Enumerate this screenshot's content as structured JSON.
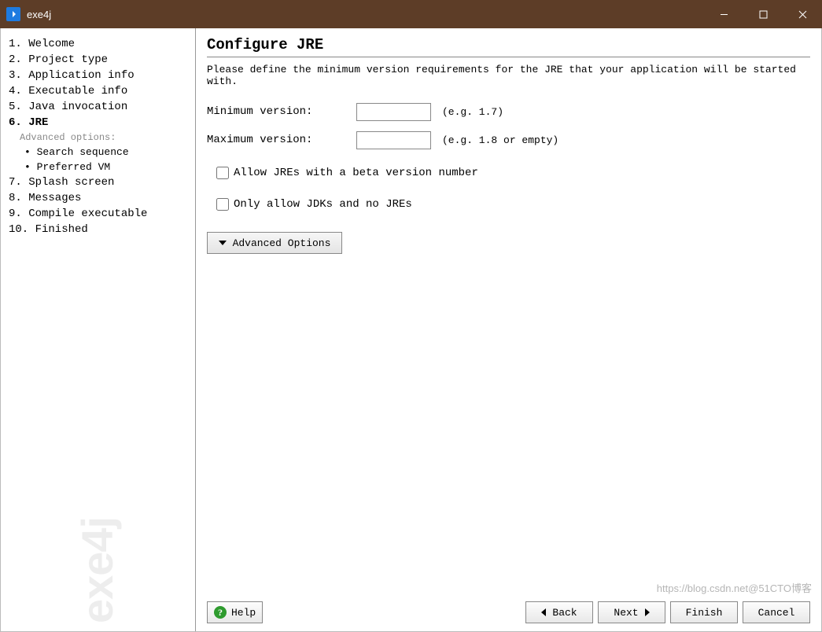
{
  "titlebar": {
    "title": "exe4j"
  },
  "sidebar": {
    "items": [
      {
        "label": "1. Welcome"
      },
      {
        "label": "2. Project type"
      },
      {
        "label": "3. Application info"
      },
      {
        "label": "4. Executable info"
      },
      {
        "label": "5. Java invocation"
      },
      {
        "label": "6. JRE",
        "active": true
      },
      {
        "label": "Advanced options:",
        "header": true
      },
      {
        "label": "• Search sequence",
        "sub": true
      },
      {
        "label": "• Preferred VM",
        "sub": true
      },
      {
        "label": "7. Splash screen"
      },
      {
        "label": "8. Messages"
      },
      {
        "label": "9. Compile executable"
      },
      {
        "label": "10. Finished"
      }
    ],
    "watermark": "exe4j"
  },
  "main": {
    "title": "Configure JRE",
    "description": "Please define the minimum version requirements for the JRE that your application will be started with.",
    "min_label": "Minimum version:",
    "min_value": "",
    "min_hint": "(e.g. 1.7)",
    "max_label": "Maximum version:",
    "max_value": "",
    "max_hint": "(e.g. 1.8 or empty)",
    "allow_beta_label": "Allow JREs with a beta version number",
    "only_jdk_label": "Only allow JDKs and no JREs",
    "advanced_btn": "Advanced Options"
  },
  "footer": {
    "help": "Help",
    "back": "Back",
    "next": "Next",
    "finish": "Finish",
    "cancel": "Cancel"
  },
  "overlay_watermark": "https://blog.csdn.net@51CTO博客"
}
